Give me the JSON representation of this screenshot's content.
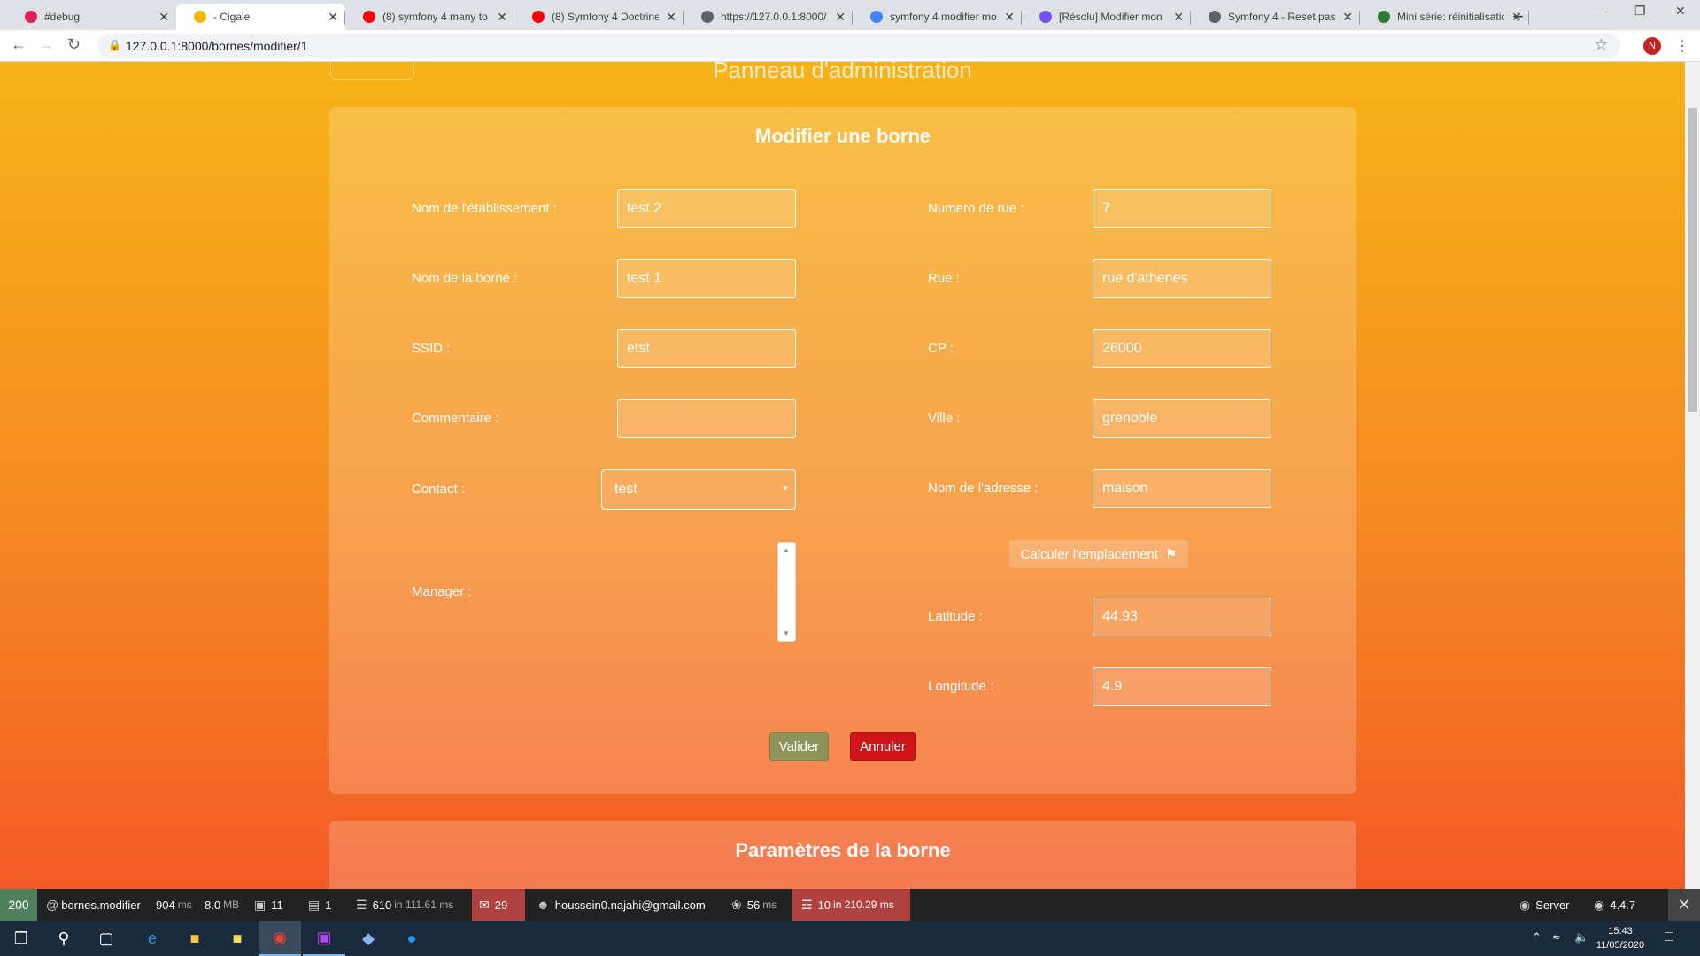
{
  "browser": {
    "tabs": [
      {
        "label": "#debug",
        "icon": "slack-icon",
        "color": "#e01e5a"
      },
      {
        "label": "- Cigale",
        "icon": "cigale-icon",
        "color": "#f4b400"
      },
      {
        "label": "(8) symfony 4 many to",
        "icon": "youtube-icon",
        "color": "#ff0000"
      },
      {
        "label": "(8) Symfony 4 Doctrine",
        "icon": "youtube-icon",
        "color": "#ff0000"
      },
      {
        "label": "https://127.0.0.1:8000/",
        "icon": "globe-icon",
        "color": "#5f6368"
      },
      {
        "label": "symfony 4 modifier mo",
        "icon": "google-icon",
        "color": "#4285f4"
      },
      {
        "label": "[Résolu] Modifier mon",
        "icon": "openclassrooms-icon",
        "color": "#7451eb"
      },
      {
        "label": "Symfony 4 - Reset pass",
        "icon": "globe-icon",
        "color": "#5f6368"
      },
      {
        "label": "Mini série: réinitialisatio",
        "icon": "leaf-icon",
        "color": "#2e7d32"
      }
    ],
    "url": "127.0.0.1:8000/bornes/modifier/1",
    "profile_initial": "N"
  },
  "page": {
    "panel_title": "Panneau d'administration",
    "card_title": "Modifier une borne",
    "left_fields": [
      {
        "label": "Nom de l'établissement :",
        "value": "test 2"
      },
      {
        "label": "Nom de la borne :",
        "value": "test 1"
      },
      {
        "label": "SSID :",
        "value": "etst"
      },
      {
        "label": "Commentaire :",
        "value": ""
      }
    ],
    "contact": {
      "label": "Contact :",
      "value": "test"
    },
    "manager": {
      "label": "Manager :"
    },
    "right_fields": [
      {
        "label": "Numero de rue :",
        "value": "7"
      },
      {
        "label": "Rue :",
        "value": "rue d'athenes"
      },
      {
        "label": "CP :",
        "value": "26000"
      },
      {
        "label": "Ville :",
        "value": "grenoble"
      },
      {
        "label": "Nom de l'adresse :",
        "value": "maison"
      }
    ],
    "calc_button": "Calculer l'emplacement",
    "latitude": {
      "label": "Latitude :",
      "value": "44.93"
    },
    "longitude": {
      "label": "Longitude :",
      "value": "4.9"
    },
    "valider_label": "Valider",
    "annuler_label": "Annuler",
    "second_card_title": "Paramètres de la borne"
  },
  "debug_toolbar": {
    "status": "200",
    "route": "bornes.modifier",
    "time": "904",
    "time_unit": "ms",
    "memory": "8.0",
    "memory_unit": "MB",
    "forms": "11",
    "logs": "1",
    "cache": "610",
    "cache_detail": "in 111.61 ms",
    "translations": "29",
    "user": "houssein0.najahi@gmail.com",
    "twig": "56",
    "twig_unit": "ms",
    "db": "10",
    "db_detail": "in 210.29 ms",
    "server": "Server",
    "version": "4.4.7",
    "colors": {
      "ok": "#4f805d",
      "warning": "#b0413e"
    }
  },
  "taskbar": {
    "time": "15:43",
    "date": "11/05/2020"
  }
}
